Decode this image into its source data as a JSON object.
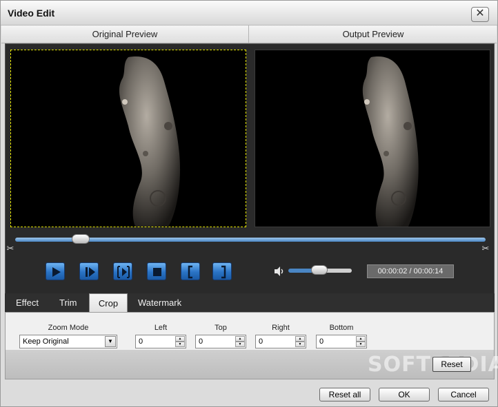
{
  "window": {
    "title": "Video Edit",
    "close_glyph": "✕"
  },
  "preview": {
    "original_label": "Original Preview",
    "output_label": "Output Preview"
  },
  "player": {
    "timecode": "00:00:02 / 00:00:14",
    "controls": [
      {
        "name": "play-button",
        "icon": "play-icon"
      },
      {
        "name": "next-frame-button",
        "icon": "next-frame-icon"
      },
      {
        "name": "frame-step-button",
        "icon": "frame-step-icon"
      },
      {
        "name": "stop-button",
        "icon": "stop-icon"
      },
      {
        "name": "mark-in-button",
        "icon": "mark-in-icon",
        "glyph": "["
      },
      {
        "name": "mark-out-button",
        "icon": "mark-out-icon",
        "glyph": "]"
      }
    ],
    "progress": 0.14,
    "volume": 0.45
  },
  "tabs": [
    {
      "label": "Effect",
      "active": false
    },
    {
      "label": "Trim",
      "active": false
    },
    {
      "label": "Crop",
      "active": true
    },
    {
      "label": "Watermark",
      "active": false
    }
  ],
  "crop": {
    "zoom_mode_label": "Zoom Mode",
    "zoom_mode_value": "Keep Original",
    "left_label": "Left",
    "left_value": "0",
    "top_label": "Top",
    "top_value": "0",
    "right_label": "Right",
    "right_value": "0",
    "bottom_label": "Bottom",
    "bottom_value": "0",
    "reset_label": "Reset"
  },
  "watermark_text": "SOFTPEDIA",
  "footer": {
    "reset_all_label": "Reset all",
    "ok_label": "OK",
    "cancel_label": "Cancel"
  },
  "colors": {
    "accent": "#2a73c5",
    "crop_border": "#e6e600",
    "panel_dark": "#2a2a2a"
  }
}
